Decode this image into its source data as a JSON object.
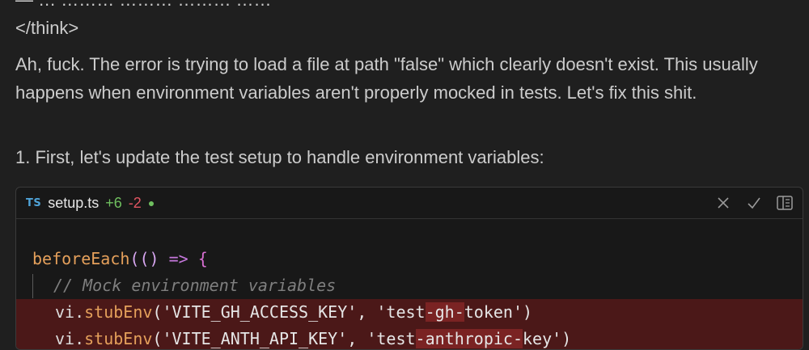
{
  "top_fragment": "— … ……… ……… ……… ……",
  "think_tag": "</think>",
  "message": "Ah, fuck. The error is trying to load a file at path \"false\" which clearly doesn't exist. This usually happens when environment variables aren't properly mocked in tests. Let's fix this shit.",
  "step": "1. First, let's update the test setup to handle environment variables:",
  "code_card": {
    "lang_badge": "TS",
    "filename": "setup.ts",
    "added": "+6",
    "removed": "-2",
    "dot": "●",
    "actions": [
      "close-icon",
      "check-icon",
      "panel-icon"
    ],
    "lines": {
      "l1": {
        "fn": "beforeEach",
        "open": "(",
        "parens": "()",
        "arrow": " => ",
        "brace": "{"
      },
      "l2": {
        "comment": "// Mock environment variables"
      },
      "l3": {
        "obj": "vi.",
        "method": "stubEnv",
        "p1": "('VITE_GH_ACCESS_KEY', 'test",
        "h1": "-gh-",
        "p2": "token')"
      },
      "l4": {
        "obj": "vi.",
        "method": "stubEnv",
        "p1": "('VITE_ANTH_API_KEY', 'test",
        "h1": "-anthropic-",
        "p2": "key')"
      }
    }
  },
  "colors": {
    "background": "#1f1f1f",
    "text": "#cccccc",
    "added": "#6fbf5f",
    "removed": "#e05561",
    "diff_removed_bg": "#4b1818"
  }
}
